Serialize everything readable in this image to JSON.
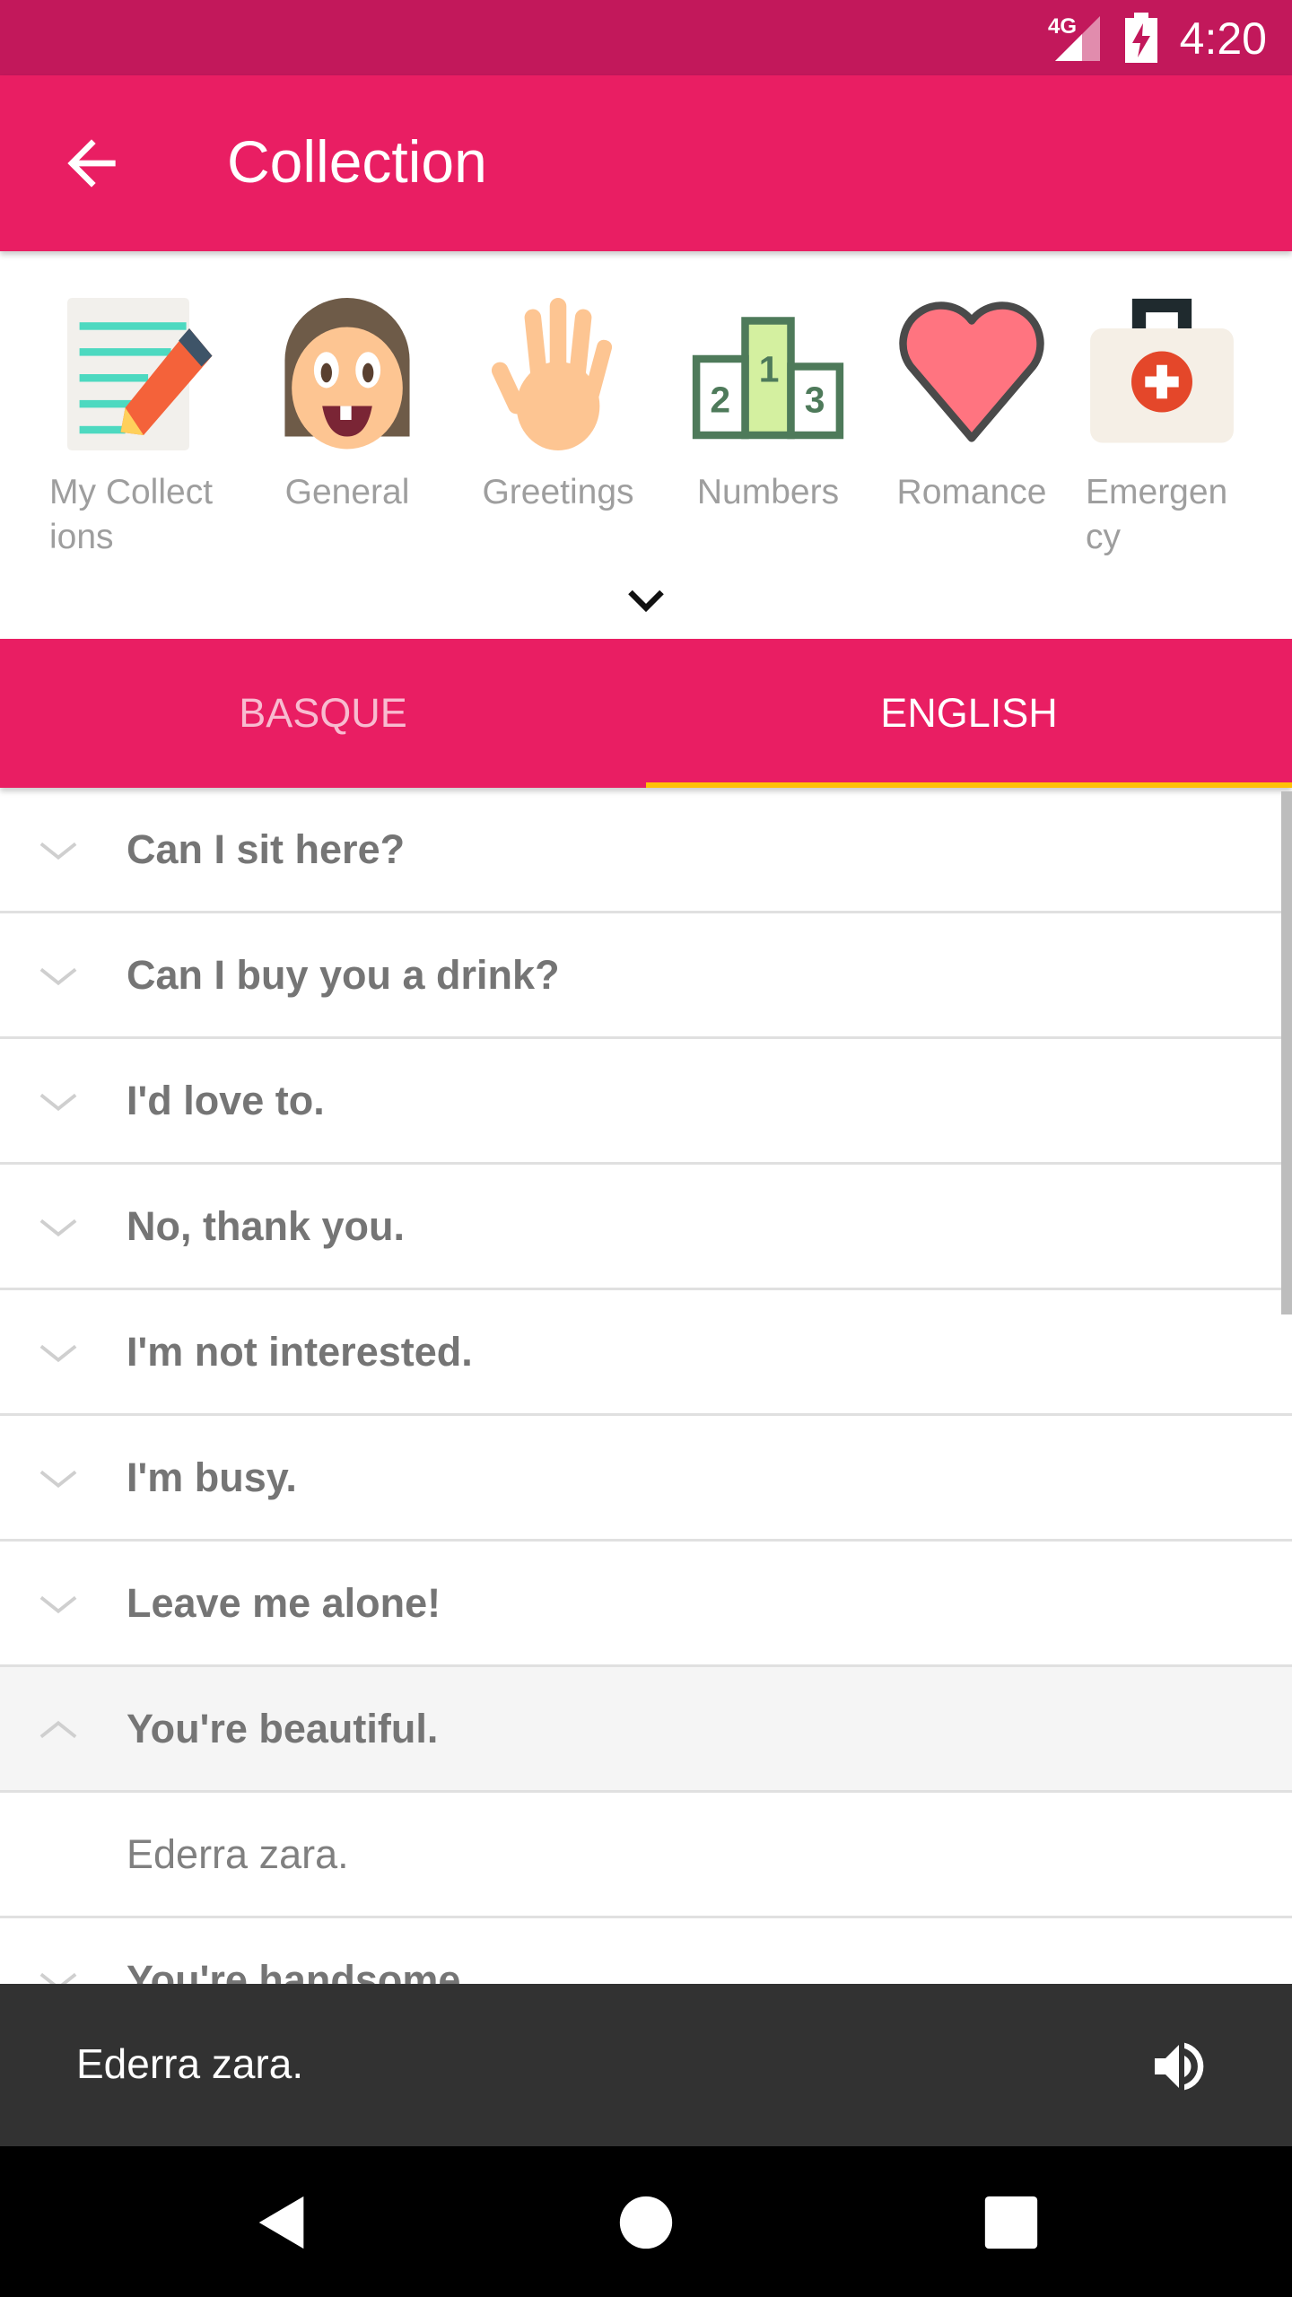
{
  "status_bar": {
    "network": "4G",
    "time": "4:20"
  },
  "app_bar": {
    "title": "Collection"
  },
  "categories": [
    {
      "label": "My Collect ions",
      "icon": "notepad-pencil-icon"
    },
    {
      "label": "General",
      "icon": "face-icon"
    },
    {
      "label": "Greetings",
      "icon": "hand-icon"
    },
    {
      "label": "Numbers",
      "icon": "podium-icon"
    },
    {
      "label": "Romance",
      "icon": "heart-icon"
    },
    {
      "label": "Emergen cy",
      "icon": "first-aid-kit-icon"
    }
  ],
  "tabs": [
    {
      "label": "BASQUE",
      "selected": false
    },
    {
      "label": "ENGLISH",
      "selected": true
    }
  ],
  "colors": {
    "primary": "#e91e63",
    "primary_dark": "#c2185b",
    "indicator": "#ffc107",
    "snackbar": "#323232"
  },
  "phrases": [
    {
      "text": "Can I sit here?",
      "expanded": false
    },
    {
      "text": "Can I buy you a drink?",
      "expanded": false
    },
    {
      "text": "I'd love to.",
      "expanded": false
    },
    {
      "text": "No, thank you.",
      "expanded": false
    },
    {
      "text": "I'm not interested.",
      "expanded": false
    },
    {
      "text": "I'm busy.",
      "expanded": false
    },
    {
      "text": "Leave me alone!",
      "expanded": false
    },
    {
      "text": "You're beautiful.",
      "expanded": true,
      "translation": "Ederra zara."
    },
    {
      "text": "You're handsome.",
      "expanded": false
    }
  ],
  "snackbar": {
    "message": "Ederra zara.",
    "icon": "speaker-icon"
  }
}
